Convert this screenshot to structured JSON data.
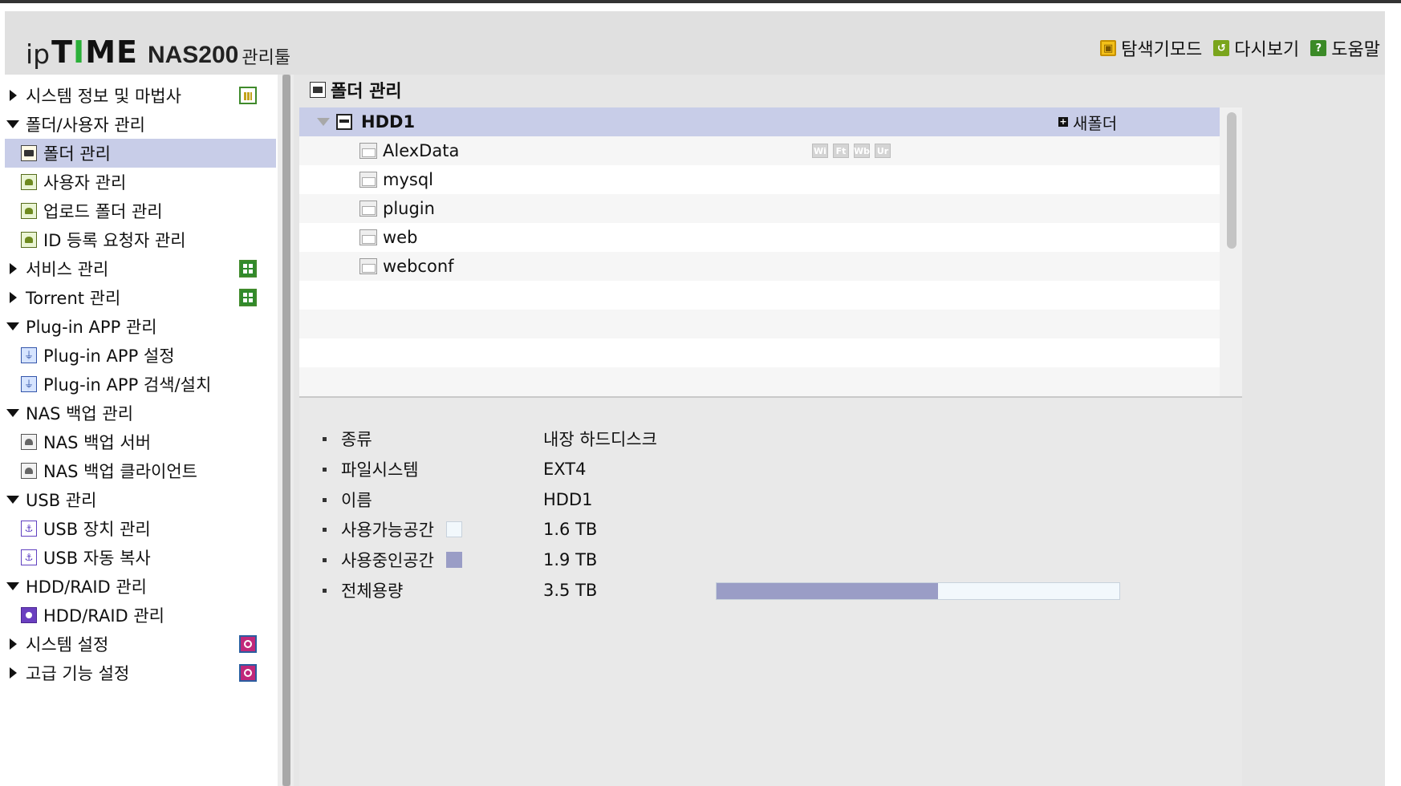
{
  "header": {
    "logo": {
      "ip": "ip",
      "time_t": "T",
      "time_rest": "ME",
      "bar": "I",
      "model": "NAS200",
      "tool": "관리툴"
    },
    "links": [
      {
        "label": "탐색기모드",
        "icon": "explorer-mode-icon"
      },
      {
        "label": "다시보기",
        "icon": "refresh-icon"
      },
      {
        "label": "도움말",
        "icon": "help-icon"
      }
    ]
  },
  "sidebar": {
    "items": [
      {
        "label": "시스템 정보 및 마법사",
        "level": 0,
        "expanded": false,
        "right_icon": "chart-icon"
      },
      {
        "label": "폴더/사용자 관리",
        "level": 0,
        "expanded": true
      },
      {
        "label": "폴더 관리",
        "level": 1,
        "icon": "folder-manage-icon",
        "selected": true
      },
      {
        "label": "사용자 관리",
        "level": 1,
        "icon": "user-manage-icon"
      },
      {
        "label": "업로드 폴더 관리",
        "level": 1,
        "icon": "upload-folder-icon"
      },
      {
        "label": "ID 등록 요청자 관리",
        "level": 1,
        "icon": "id-request-icon"
      },
      {
        "label": "서비스 관리",
        "level": 0,
        "expanded": false,
        "right_icon": "service-icon"
      },
      {
        "label": "Torrent 관리",
        "level": 0,
        "expanded": false,
        "right_icon": "torrent-icon"
      },
      {
        "label": "Plug-in APP 관리",
        "level": 0,
        "expanded": true
      },
      {
        "label": "Plug-in APP 설정",
        "level": 1,
        "icon": "plugin-icon"
      },
      {
        "label": "Plug-in APP 검색/설치",
        "level": 1,
        "icon": "plugin-icon"
      },
      {
        "label": "NAS 백업 관리",
        "level": 0,
        "expanded": true
      },
      {
        "label": "NAS 백업 서버",
        "level": 1,
        "icon": "backup-icon"
      },
      {
        "label": "NAS 백업 클라이언트",
        "level": 1,
        "icon": "backup-icon"
      },
      {
        "label": "USB 관리",
        "level": 0,
        "expanded": true
      },
      {
        "label": "USB 장치 관리",
        "level": 1,
        "icon": "usb-icon"
      },
      {
        "label": "USB 자동 복사",
        "level": 1,
        "icon": "usb-icon"
      },
      {
        "label": "HDD/RAID 관리",
        "level": 0,
        "expanded": true
      },
      {
        "label": "HDD/RAID 관리",
        "level": 1,
        "icon": "hdd-icon"
      },
      {
        "label": "시스템 설정",
        "level": 0,
        "expanded": false,
        "right_icon": "settings-icon"
      },
      {
        "label": "고급 기능 설정",
        "level": 0,
        "expanded": false,
        "right_icon": "advanced-settings-icon"
      }
    ]
  },
  "main": {
    "title": "폴더 관리",
    "tree": {
      "root": {
        "label": "HDD1",
        "new_folder_label": "새폴더"
      },
      "folders": [
        {
          "label": "AlexData",
          "flags": [
            "Wi",
            "Ft",
            "Wb",
            "Ur"
          ]
        },
        {
          "label": "mysql",
          "flags": []
        },
        {
          "label": "plugin",
          "flags": []
        },
        {
          "label": "web",
          "flags": []
        },
        {
          "label": "webconf",
          "flags": []
        }
      ]
    },
    "info": {
      "rows": [
        {
          "label": "종류",
          "value": "내장 하드디스크"
        },
        {
          "label": "파일시스템",
          "value": "EXT4"
        },
        {
          "label": "이름",
          "value": "HDD1"
        },
        {
          "label": "사용가능공간",
          "value": "1.6 TB",
          "swatch": "#f2f8fc"
        },
        {
          "label": "사용중인공간",
          "value": "1.9 TB",
          "swatch": "#9a9dc6"
        },
        {
          "label": "전체용량",
          "value": "3.5 TB"
        }
      ],
      "used_fraction": 0.55
    }
  },
  "colors": {
    "selected_bg": "#c8cde8",
    "used": "#9a9dc6",
    "free": "#f2f8fc",
    "logo_accent": "#2bb039"
  }
}
